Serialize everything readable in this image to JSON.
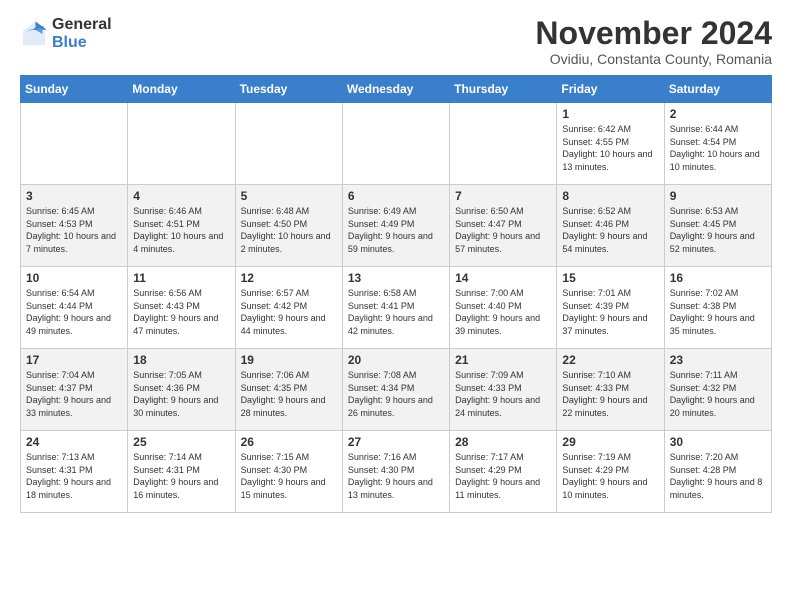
{
  "logo": {
    "general": "General",
    "blue": "Blue"
  },
  "title": "November 2024",
  "subtitle": "Ovidiu, Constanta County, Romania",
  "days_of_week": [
    "Sunday",
    "Monday",
    "Tuesday",
    "Wednesday",
    "Thursday",
    "Friday",
    "Saturday"
  ],
  "weeks": [
    [
      {
        "day": "",
        "info": ""
      },
      {
        "day": "",
        "info": ""
      },
      {
        "day": "",
        "info": ""
      },
      {
        "day": "",
        "info": ""
      },
      {
        "day": "",
        "info": ""
      },
      {
        "day": "1",
        "info": "Sunrise: 6:42 AM\nSunset: 4:55 PM\nDaylight: 10 hours and 13 minutes."
      },
      {
        "day": "2",
        "info": "Sunrise: 6:44 AM\nSunset: 4:54 PM\nDaylight: 10 hours and 10 minutes."
      }
    ],
    [
      {
        "day": "3",
        "info": "Sunrise: 6:45 AM\nSunset: 4:53 PM\nDaylight: 10 hours and 7 minutes."
      },
      {
        "day": "4",
        "info": "Sunrise: 6:46 AM\nSunset: 4:51 PM\nDaylight: 10 hours and 4 minutes."
      },
      {
        "day": "5",
        "info": "Sunrise: 6:48 AM\nSunset: 4:50 PM\nDaylight: 10 hours and 2 minutes."
      },
      {
        "day": "6",
        "info": "Sunrise: 6:49 AM\nSunset: 4:49 PM\nDaylight: 9 hours and 59 minutes."
      },
      {
        "day": "7",
        "info": "Sunrise: 6:50 AM\nSunset: 4:47 PM\nDaylight: 9 hours and 57 minutes."
      },
      {
        "day": "8",
        "info": "Sunrise: 6:52 AM\nSunset: 4:46 PM\nDaylight: 9 hours and 54 minutes."
      },
      {
        "day": "9",
        "info": "Sunrise: 6:53 AM\nSunset: 4:45 PM\nDaylight: 9 hours and 52 minutes."
      }
    ],
    [
      {
        "day": "10",
        "info": "Sunrise: 6:54 AM\nSunset: 4:44 PM\nDaylight: 9 hours and 49 minutes."
      },
      {
        "day": "11",
        "info": "Sunrise: 6:56 AM\nSunset: 4:43 PM\nDaylight: 9 hours and 47 minutes."
      },
      {
        "day": "12",
        "info": "Sunrise: 6:57 AM\nSunset: 4:42 PM\nDaylight: 9 hours and 44 minutes."
      },
      {
        "day": "13",
        "info": "Sunrise: 6:58 AM\nSunset: 4:41 PM\nDaylight: 9 hours and 42 minutes."
      },
      {
        "day": "14",
        "info": "Sunrise: 7:00 AM\nSunset: 4:40 PM\nDaylight: 9 hours and 39 minutes."
      },
      {
        "day": "15",
        "info": "Sunrise: 7:01 AM\nSunset: 4:39 PM\nDaylight: 9 hours and 37 minutes."
      },
      {
        "day": "16",
        "info": "Sunrise: 7:02 AM\nSunset: 4:38 PM\nDaylight: 9 hours and 35 minutes."
      }
    ],
    [
      {
        "day": "17",
        "info": "Sunrise: 7:04 AM\nSunset: 4:37 PM\nDaylight: 9 hours and 33 minutes."
      },
      {
        "day": "18",
        "info": "Sunrise: 7:05 AM\nSunset: 4:36 PM\nDaylight: 9 hours and 30 minutes."
      },
      {
        "day": "19",
        "info": "Sunrise: 7:06 AM\nSunset: 4:35 PM\nDaylight: 9 hours and 28 minutes."
      },
      {
        "day": "20",
        "info": "Sunrise: 7:08 AM\nSunset: 4:34 PM\nDaylight: 9 hours and 26 minutes."
      },
      {
        "day": "21",
        "info": "Sunrise: 7:09 AM\nSunset: 4:33 PM\nDaylight: 9 hours and 24 minutes."
      },
      {
        "day": "22",
        "info": "Sunrise: 7:10 AM\nSunset: 4:33 PM\nDaylight: 9 hours and 22 minutes."
      },
      {
        "day": "23",
        "info": "Sunrise: 7:11 AM\nSunset: 4:32 PM\nDaylight: 9 hours and 20 minutes."
      }
    ],
    [
      {
        "day": "24",
        "info": "Sunrise: 7:13 AM\nSunset: 4:31 PM\nDaylight: 9 hours and 18 minutes."
      },
      {
        "day": "25",
        "info": "Sunrise: 7:14 AM\nSunset: 4:31 PM\nDaylight: 9 hours and 16 minutes."
      },
      {
        "day": "26",
        "info": "Sunrise: 7:15 AM\nSunset: 4:30 PM\nDaylight: 9 hours and 15 minutes."
      },
      {
        "day": "27",
        "info": "Sunrise: 7:16 AM\nSunset: 4:30 PM\nDaylight: 9 hours and 13 minutes."
      },
      {
        "day": "28",
        "info": "Sunrise: 7:17 AM\nSunset: 4:29 PM\nDaylight: 9 hours and 11 minutes."
      },
      {
        "day": "29",
        "info": "Sunrise: 7:19 AM\nSunset: 4:29 PM\nDaylight: 9 hours and 10 minutes."
      },
      {
        "day": "30",
        "info": "Sunrise: 7:20 AM\nSunset: 4:28 PM\nDaylight: 9 hours and 8 minutes."
      }
    ]
  ]
}
